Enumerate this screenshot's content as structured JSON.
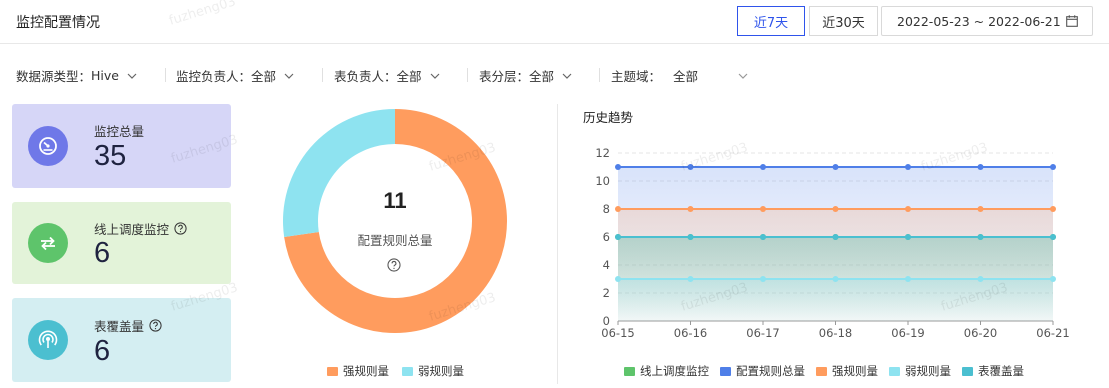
{
  "header": {
    "title": "监控配置情况",
    "range_buttons": [
      "近7天",
      "近30天"
    ],
    "active_range": "近7天",
    "date_range": "2022-05-23 ~ 2022-06-21",
    "calendar_icon": "calendar-icon"
  },
  "filters": [
    {
      "label": "数据源类型：",
      "value": "Hive"
    },
    {
      "label": "监控负责人：",
      "value": "全部"
    },
    {
      "label": "表负责人：",
      "value": "全部"
    },
    {
      "label": "表分层：",
      "value": "全部"
    },
    {
      "label": "主题域：",
      "value": "全部"
    }
  ],
  "stats": [
    {
      "label": "监控总量",
      "value": "35",
      "icon": "gauge-icon",
      "bg": "#d6d6f7",
      "icon_color": "#6f78e8",
      "help": false
    },
    {
      "label": "线上调度监控",
      "value": "6",
      "icon": "sync-arrows-icon",
      "bg": "#e3f3d9",
      "icon_color": "#5ec46b",
      "help": true
    },
    {
      "label": "表覆盖量",
      "value": "6",
      "icon": "broadcast-icon",
      "bg": "#d4eef2",
      "icon_color": "#4bbfd0",
      "help": true
    }
  ],
  "donut": {
    "total": "11",
    "label": "配置规则总量",
    "help_icon": "help-icon",
    "slices": [
      {
        "name": "强规则量",
        "value": 8,
        "color": "#ff9c5e"
      },
      {
        "name": "弱规则量",
        "value": 3,
        "color": "#8ee3f0"
      }
    ]
  },
  "trend": {
    "title": "历史趋势"
  },
  "chart_data": {
    "type": "line",
    "categories": [
      "06-15",
      "06-16",
      "06-17",
      "06-18",
      "06-19",
      "06-20",
      "06-21"
    ],
    "ylim": [
      0,
      12
    ],
    "yticks": [
      0,
      2,
      4,
      6,
      8,
      10,
      12
    ],
    "grid": true,
    "legend_position": "bottom",
    "series": [
      {
        "name": "线上调度监控",
        "values": [
          6,
          6,
          6,
          6,
          6,
          6,
          6
        ],
        "color": "#5ec46b"
      },
      {
        "name": "配置规则总量",
        "values": [
          11,
          11,
          11,
          11,
          11,
          11,
          11
        ],
        "color": "#4f7fe8"
      },
      {
        "name": "强规则量",
        "values": [
          8,
          8,
          8,
          8,
          8,
          8,
          8
        ],
        "color": "#ff9c5e"
      },
      {
        "name": "弱规则量",
        "values": [
          3,
          3,
          3,
          3,
          3,
          3,
          3
        ],
        "color": "#8ee3f0"
      },
      {
        "name": "表覆盖量",
        "values": [
          6,
          6,
          6,
          6,
          6,
          6,
          6
        ],
        "color": "#4bbfd0"
      }
    ]
  },
  "watermark": "fuzheng03"
}
